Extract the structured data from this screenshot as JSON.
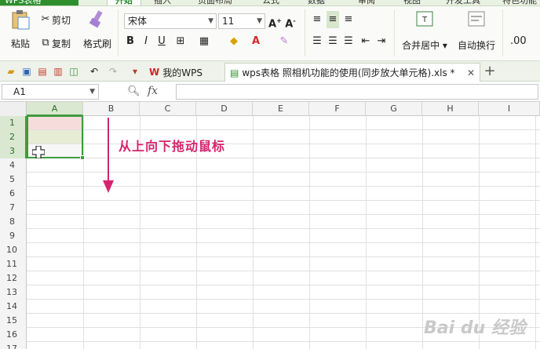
{
  "menubar": {
    "app_title": "WPS表格",
    "tabs": [
      {
        "label": "开始",
        "active": true
      },
      {
        "label": "插入",
        "active": false
      },
      {
        "label": "页面布局",
        "active": false
      },
      {
        "label": "公式",
        "active": false
      },
      {
        "label": "数据",
        "active": false
      },
      {
        "label": "审阅",
        "active": false
      },
      {
        "label": "视图",
        "active": false
      },
      {
        "label": "开发工具",
        "active": false
      },
      {
        "label": "特色功能",
        "active": false
      }
    ]
  },
  "ribbon": {
    "cut": "剪切",
    "paste": "粘贴",
    "copy": "复制",
    "format_painter": "格式刷",
    "font_name": "宋体",
    "font_size": "11",
    "bold": "B",
    "italic": "I",
    "underline": "U",
    "merge_center": "合并居中",
    "wrap_text": "自动换行"
  },
  "quickbar": {
    "tabs": [
      {
        "label": "我的WPS",
        "active": false
      },
      {
        "label": "wps表格 照相机功能的使用(同步放大单元格).xls *",
        "active": true
      }
    ],
    "new_tab": "+"
  },
  "formula_bar": {
    "name_box": "A1",
    "fx_label": "fx",
    "value": ""
  },
  "grid": {
    "columns": [
      "A",
      "B",
      "C",
      "D",
      "E",
      "F",
      "G",
      "H",
      "I"
    ],
    "rows": [
      "1",
      "2",
      "3",
      "4",
      "5",
      "6",
      "7",
      "8",
      "9",
      "10",
      "11",
      "12",
      "13",
      "14",
      "15",
      "16",
      "17"
    ],
    "selected_column": "A",
    "selected_rows": [
      "1",
      "2",
      "3"
    ]
  },
  "annotation": "从上向下拖动鼠标",
  "watermark": "Bai du 经验",
  "colors": {
    "accent_green": "#3f9b3f",
    "annotation": "#d6246e",
    "cell1": "#f7dcdc",
    "cell2": "#e7ecd4",
    "cell3": "#f7f7f7"
  }
}
